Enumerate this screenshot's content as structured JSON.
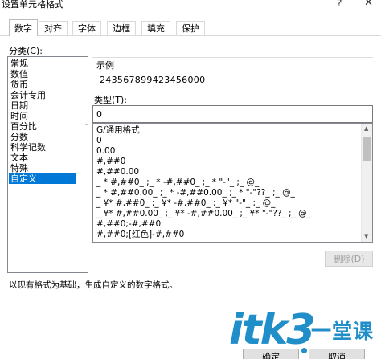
{
  "window": {
    "title": "设置单元格格式",
    "help_glyph": "?",
    "close_glyph": "✕"
  },
  "tabs": [
    {
      "label": "数字"
    },
    {
      "label": "对齐"
    },
    {
      "label": "字体"
    },
    {
      "label": "边框"
    },
    {
      "label": "填充"
    },
    {
      "label": "保护"
    }
  ],
  "category": {
    "label": "分类(C):",
    "selected": "自定义",
    "items": [
      "常规",
      "数值",
      "货币",
      "会计专用",
      "日期",
      "时间",
      "百分比",
      "分数",
      "科学记数",
      "文本",
      "特殊",
      "自定义"
    ]
  },
  "sample": {
    "label": "示例",
    "value": "243567899423456000"
  },
  "type": {
    "label": "类型(T):",
    "value": "0"
  },
  "formats": [
    "G/通用格式",
    "0",
    "0.00",
    "#,##0",
    "#,##0.00",
    "_ * #,##0_ ;_ * -#,##0_ ;_ * \"-\"_ ;_ @_",
    "_ * #,##0.00_ ;_ * -#,##0.00_ ;_ * \"-\"??_ ;_ @_",
    "_ ¥* #,##0_ ;_ ¥* -#,##0_ ;_ ¥* \"-\"_ ;_ @_",
    "_ ¥* #,##0.00_ ;_ ¥* -#,##0.00_ ;_ ¥* \"-\"??_ ;_ @_",
    "#,##0;-#,##0",
    "#,##0;[红色]-#,##0"
  ],
  "buttons": {
    "delete": "删除(D)",
    "ok": "确定",
    "cancel": "取消"
  },
  "description": "以现有格式为基础，生成自定义的数字格式。",
  "watermark": {
    "latin": "itk3",
    "cn": "一堂课"
  },
  "colors": {
    "selection": "#0078d7",
    "watermark": "#1f8ec9"
  }
}
